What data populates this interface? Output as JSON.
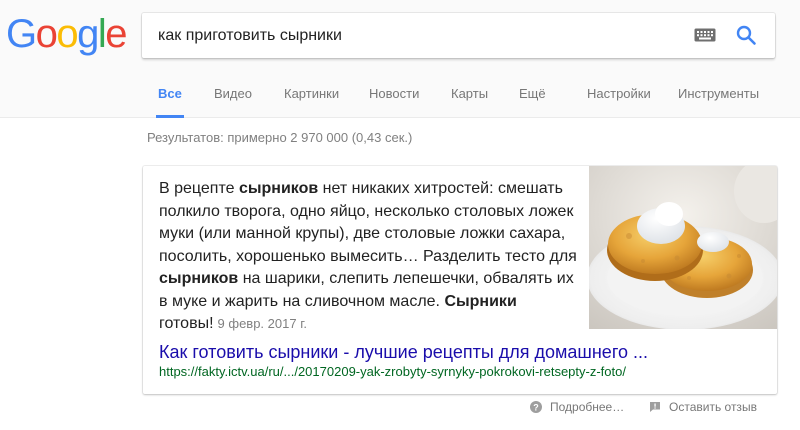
{
  "logo": {
    "letters": [
      "G",
      "o",
      "o",
      "g",
      "l",
      "e"
    ],
    "colors": [
      "#4285F4",
      "#EA4335",
      "#FBBC05",
      "#4285F4",
      "#34A853",
      "#EA4335"
    ]
  },
  "search": {
    "query": "как приготовить сырники",
    "icons": [
      "keyboard-icon",
      "search-icon"
    ]
  },
  "tabs": [
    {
      "label": "Все",
      "active": true
    },
    {
      "label": "Видео"
    },
    {
      "label": "Картинки"
    },
    {
      "label": "Новости"
    },
    {
      "label": "Карты"
    },
    {
      "label": "Ещё"
    },
    {
      "label": "Настройки"
    },
    {
      "label": "Инструменты"
    }
  ],
  "stats": "Результатов: примерно 2 970 000 (0,43 сек.)",
  "featured": {
    "s1": "В рецепте ",
    "s2": "сырников",
    "s3": " нет никаких хитростей: смешать полкило творога, одно яйцо, несколько столовых ложек муки (или манной крупы), две столовые ложки сахара, посолить, хорошенько вымесить… Разделить тесто для ",
    "s4": "сырников",
    "s5": " на шарики, слепить лепешечки, обвалять их в муке и жарить на сливочном масле. ",
    "s6": "Сырники",
    "s7": " готовы!",
    "date": "9 февр. 2017 г.",
    "title": "Как готовить сырники - лучшие рецепты для домашнего ...",
    "url": "https://fakty.ictv.ua/ru/.../20170209-yak-zrobyty-syrnyky-pokrokovi-retsepty-z-foto/"
  },
  "footer": {
    "more": "Подробнее…",
    "feedback": "Оставить отзыв"
  },
  "accent": "#4285f4",
  "link_color": "#1a0dab",
  "url_color": "#006621"
}
